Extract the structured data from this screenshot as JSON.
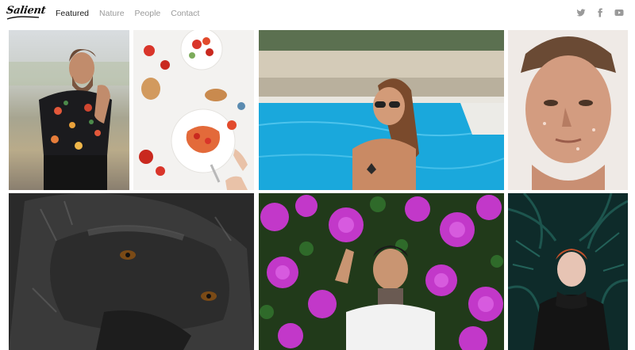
{
  "brand": {
    "logo_text": "Salient"
  },
  "nav": {
    "items": [
      {
        "label": "Featured",
        "active": true
      },
      {
        "label": "Nature",
        "active": false
      },
      {
        "label": "People",
        "active": false
      },
      {
        "label": "Contact",
        "active": false
      }
    ]
  },
  "social": [
    "twitter-icon",
    "facebook-icon",
    "youtube-icon"
  ],
  "colors": {
    "nav_active": "#1a1a1a",
    "nav_inactive": "#9a9a9a",
    "icon": "#9a9a9a",
    "background": "#ffffff"
  },
  "gallery": {
    "tiles": [
      {
        "subject": "man-floral-shirt"
      },
      {
        "subject": "food-flat-lay"
      },
      {
        "subject": "woman-pool"
      },
      {
        "subject": "man-portrait"
      },
      {
        "subject": "gorilla"
      },
      {
        "subject": "man-flowers"
      },
      {
        "subject": "red-hair-man-plants"
      }
    ]
  }
}
